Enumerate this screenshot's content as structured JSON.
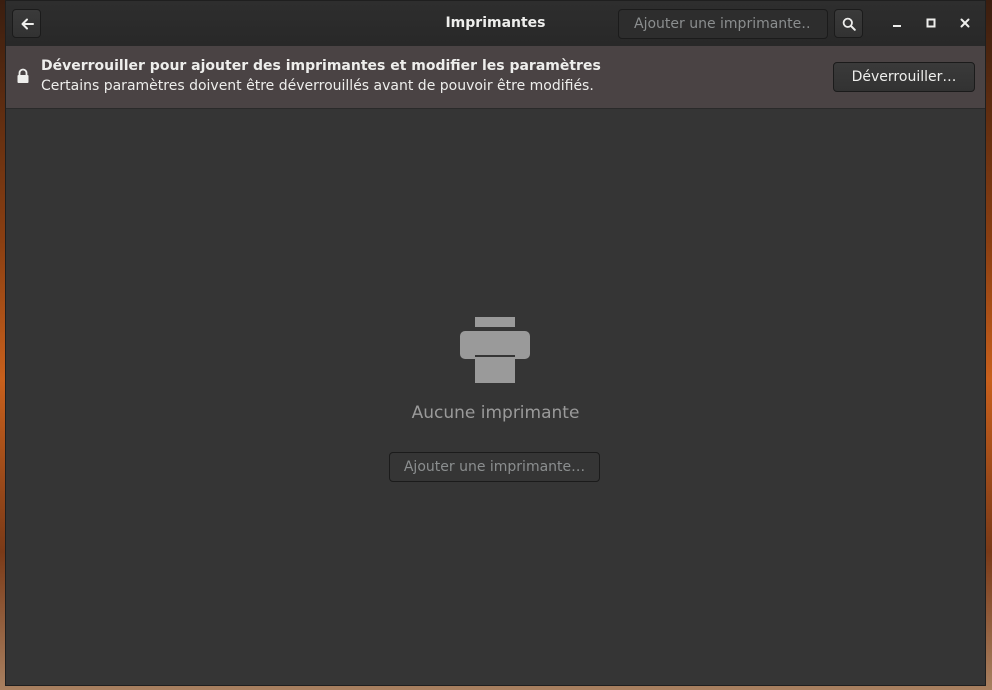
{
  "header": {
    "title": "Imprimantes",
    "search_placeholder": "Ajouter une imprimante…",
    "back_icon": "arrow-left-icon",
    "search_icon": "search-icon",
    "minimize_icon": "minimize-icon",
    "maximize_icon": "maximize-icon",
    "close_icon": "close-icon"
  },
  "infobar": {
    "title": "Déverrouiller pour ajouter des imprimantes et modifier les paramètres",
    "subtitle": "Certains paramètres doivent être déverrouillés avant de pouvoir être modifiés.",
    "unlock_label": "Déverrouiller…",
    "lock_icon": "lock-icon",
    "background_color": "#4a4344"
  },
  "empty_state": {
    "icon": "printer-icon",
    "label": "Aucune imprimante",
    "add_button_label": "Ajouter une imprimante…"
  }
}
